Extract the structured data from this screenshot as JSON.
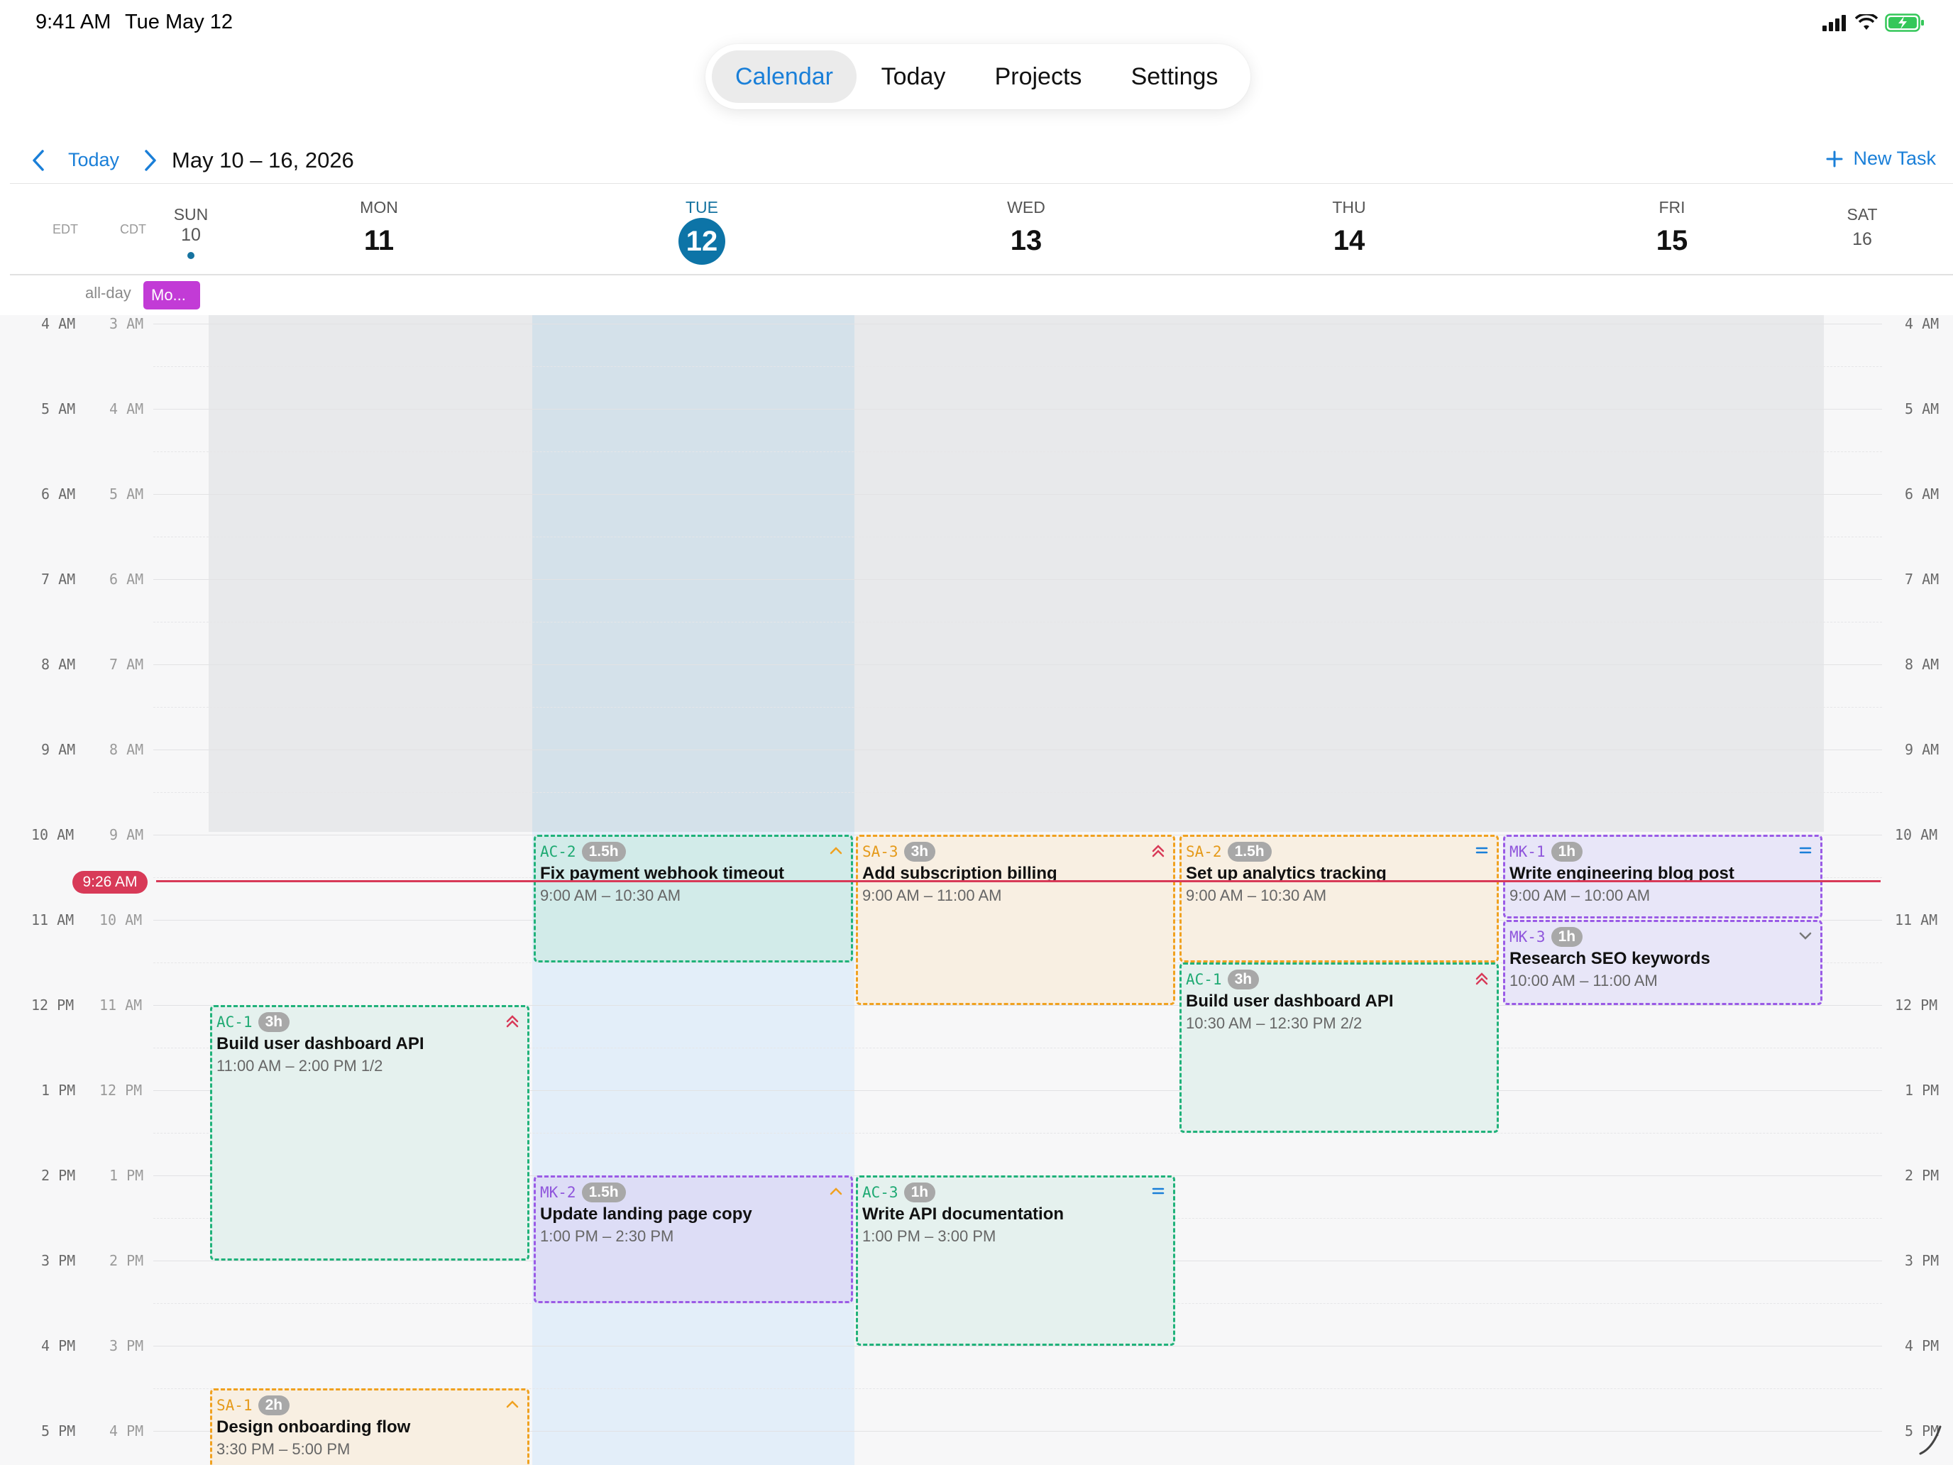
{
  "status_bar": {
    "time": "9:41 AM",
    "date": "Tue May 12"
  },
  "nav": {
    "tabs": [
      {
        "label": "Calendar",
        "active": true
      },
      {
        "label": "Today",
        "active": false
      },
      {
        "label": "Projects",
        "active": false
      },
      {
        "label": "Settings",
        "active": false
      }
    ]
  },
  "toolbar": {
    "today_label": "Today",
    "range": "May 10 – 16, 2026",
    "new_task_label": "New Task"
  },
  "timezones": {
    "primary": "EDT",
    "secondary": "CDT"
  },
  "days": [
    {
      "name": "SUN",
      "num": "10"
    },
    {
      "name": "MON",
      "num": "11"
    },
    {
      "name": "TUE",
      "num": "12"
    },
    {
      "name": "WED",
      "num": "13"
    },
    {
      "name": "THU",
      "num": "14"
    },
    {
      "name": "FRI",
      "num": "15"
    },
    {
      "name": "SAT",
      "num": "16"
    }
  ],
  "all_day": {
    "label": "all-day",
    "event": "Mo..."
  },
  "hours_edt": [
    "4 AM",
    "5 AM",
    "6 AM",
    "7 AM",
    "8 AM",
    "9 AM",
    "10 AM",
    "11 AM",
    "12 PM",
    "1 PM",
    "2 PM",
    "3 PM",
    "4 PM",
    "5 PM"
  ],
  "hours_cdt": [
    "3 AM",
    "4 AM",
    "5 AM",
    "6 AM",
    "7 AM",
    "8 AM",
    "9 AM",
    "10 AM",
    "11 AM",
    "12 PM",
    "1 PM",
    "2 PM",
    "3 PM",
    "4 PM"
  ],
  "now_label": "9:26 AM",
  "events": [
    {
      "code": "AC-2",
      "dur": "1.5h",
      "title": "Fix payment webhook timeout",
      "time": "9:00 AM – 10:30 AM",
      "prio": "chevron-up"
    },
    {
      "code": "SA-3",
      "dur": "3h",
      "title": "Add subscription billing",
      "time": "9:00 AM – 11:00 AM",
      "prio": "double-chevron-up"
    },
    {
      "code": "SA-2",
      "dur": "1.5h",
      "title": "Set up analytics tracking",
      "time": "9:00 AM – 10:30 AM",
      "prio": "equals"
    },
    {
      "code": "MK-1",
      "dur": "1h",
      "title": "Write engineering blog post",
      "time": "9:00 AM – 10:00 AM",
      "prio": "equals"
    },
    {
      "code": "MK-3",
      "dur": "1h",
      "title": "Research SEO keywords",
      "time": "10:00 AM – 11:00 AM",
      "prio": "chevron-down"
    },
    {
      "code": "AC-1",
      "dur": "3h",
      "title": "Build user dashboard API",
      "time": "10:30 AM – 12:30 PM 2/2",
      "prio": "double-chevron-up"
    },
    {
      "code": "AC-1",
      "dur": "3h",
      "title": "Build user dashboard API",
      "time": "11:00 AM – 2:00 PM 1/2",
      "prio": "double-chevron-up"
    },
    {
      "code": "MK-2",
      "dur": "1.5h",
      "title": "Update landing page copy",
      "time": "1:00 PM – 2:30 PM",
      "prio": "chevron-up"
    },
    {
      "code": "AC-3",
      "dur": "1h",
      "title": "Write API documentation",
      "time": "1:00 PM – 3:00 PM",
      "prio": "equals"
    },
    {
      "code": "SA-1",
      "dur": "2h",
      "title": "Design onboarding flow",
      "time": "3:30 PM – 5:00 PM",
      "prio": "chevron-up"
    }
  ],
  "colors": {
    "accent": "#1a7fd8",
    "now": "#d83a58",
    "green": "#20b27a",
    "orange": "#f0a120",
    "purple": "#9a5be6",
    "today": "#0d74a7",
    "allday": "#c23bd6"
  }
}
